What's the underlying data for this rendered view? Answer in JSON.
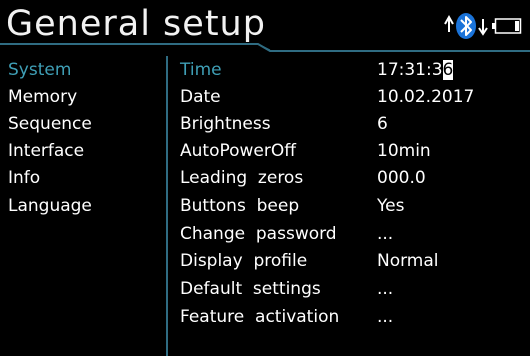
{
  "header": {
    "title": "General setup",
    "bluetooth_icon": "bluetooth-transfer-icon",
    "battery_icon": "battery-icon"
  },
  "menu": {
    "items": [
      {
        "label": "System",
        "active": true
      },
      {
        "label": "Memory",
        "active": false
      },
      {
        "label": "Sequence",
        "active": false
      },
      {
        "label": "Interface",
        "active": false
      },
      {
        "label": "Info",
        "active": false
      },
      {
        "label": "Language",
        "active": false
      }
    ]
  },
  "settings": {
    "rows": [
      {
        "label": "Time",
        "value_prefix": "17:31:3",
        "value_cursor": "6",
        "active": true
      },
      {
        "label": "Date",
        "value": "10.02.2017"
      },
      {
        "label": "Brightness",
        "value": "6"
      },
      {
        "label": "AutoPowerOff",
        "value": "10min"
      },
      {
        "label": "Leading  zeros",
        "value": "000.0"
      },
      {
        "label": "Buttons  beep",
        "value": "Yes"
      },
      {
        "label": "Change  password",
        "value": "..."
      },
      {
        "label": "Display  profile",
        "value": "Normal"
      },
      {
        "label": "Default  settings",
        "value": "..."
      },
      {
        "label": "Feature  activation",
        "value": "..."
      }
    ]
  },
  "colors": {
    "accent": "#3f9fb6",
    "divider": "#2f6c82",
    "background": "#000000",
    "text": "#ffffff"
  }
}
